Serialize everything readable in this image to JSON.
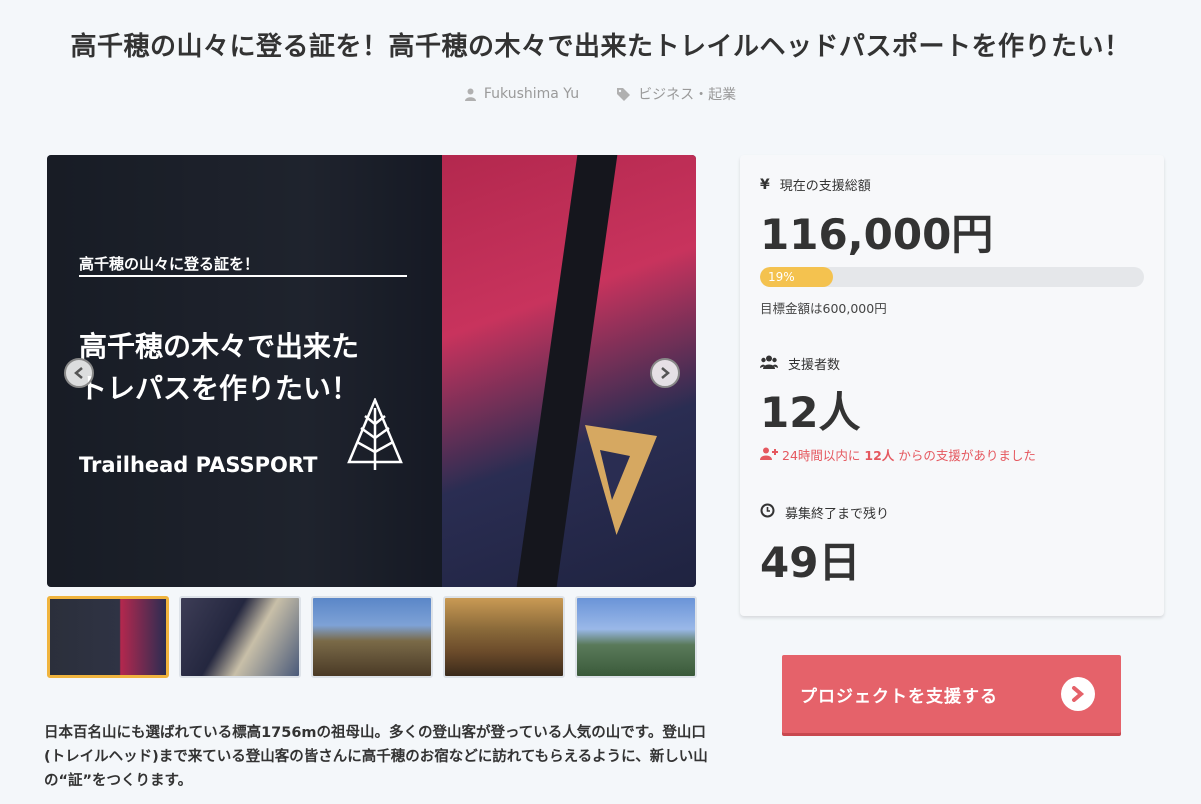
{
  "project": {
    "title": "高千穂の山々に登る証を！高千穂の木々で出来たトレイルヘッドパスポートを作りたい！",
    "author": "Fukushima Yu",
    "category": "ビジネス・起業"
  },
  "hero": {
    "subtitle": "高千穂の山々に登る証を！",
    "headline_line1": "高千穂の木々で出来た",
    "headline_line2": "トレパスを作りたい！",
    "brand": "Trailhead PASSPORT"
  },
  "thumbnails": [
    {
      "label": "thumbnail-1",
      "active": true
    },
    {
      "label": "thumbnail-2",
      "active": false
    },
    {
      "label": "thumbnail-3",
      "active": false
    },
    {
      "label": "thumbnail-4",
      "active": false
    },
    {
      "label": "thumbnail-5",
      "active": false
    }
  ],
  "description": "日本百名山にも選ばれている標高1756mの祖母山。多くの登山客が登っている人気の山です。登山口(トレイルヘッド)まで来ている登山客の皆さんに高千穂のお宿などに訪れてもらえるように、新しい山の“証”をつくります。",
  "stats": {
    "total_label": "現在の支援総額",
    "total_icon": "¥",
    "total_value": "116,000円",
    "progress_percent": 19,
    "progress_text": "19%",
    "goal_text": "目標金額は600,000円",
    "supporters_label": "支援者数",
    "supporters_value": "12人",
    "recent_prefix": "24時間以内に",
    "recent_count": "12人",
    "recent_suffix": "からの支援がありました",
    "remaining_label": "募集終了まで残り",
    "remaining_value": "49日"
  },
  "cta": {
    "label": "プロジェクトを支援する"
  },
  "colors": {
    "accent": "#e5626a",
    "progress": "#f4c24f",
    "alert": "#e5585f",
    "active_thumb": "#f0b43e"
  }
}
